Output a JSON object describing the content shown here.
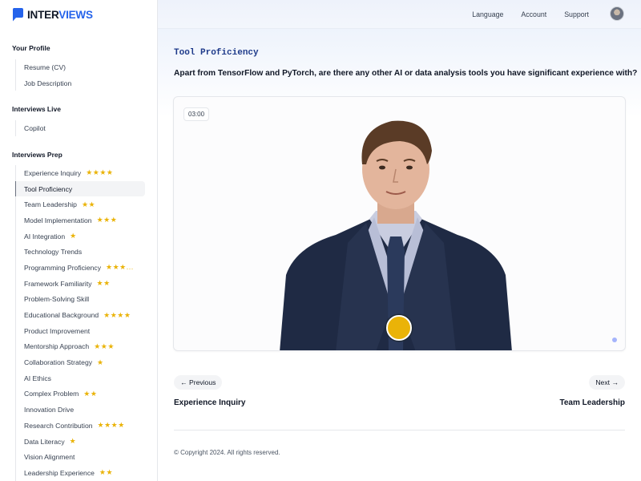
{
  "brand": {
    "name_bold": "INTER",
    "name_light": "VIEWS"
  },
  "topnav": [
    "Language",
    "Account",
    "Support"
  ],
  "sidebar": {
    "profile_title": "Your Profile",
    "profile_items": [
      "Resume (CV)",
      "Job Description"
    ],
    "live_title": "Interviews Live",
    "live_items": [
      "Copilot"
    ],
    "prep_title": "Interviews Prep",
    "prep_items": [
      {
        "label": "Experience Inquiry",
        "stars": "★★★★"
      },
      {
        "label": "Tool Proficiency",
        "stars": ""
      },
      {
        "label": "Team Leadership",
        "stars": "★★"
      },
      {
        "label": "Model Implementation",
        "stars": "★★★"
      },
      {
        "label": "AI Integration",
        "stars": "★"
      },
      {
        "label": "Technology Trends",
        "stars": ""
      },
      {
        "label": "Programming Proficiency",
        "stars": "★★★..."
      },
      {
        "label": "Framework Familiarity",
        "stars": "★★"
      },
      {
        "label": "Problem-Solving Skill",
        "stars": ""
      },
      {
        "label": "Educational Background",
        "stars": "★★★★"
      },
      {
        "label": "Product Improvement",
        "stars": ""
      },
      {
        "label": "Mentorship Approach",
        "stars": "★★★"
      },
      {
        "label": "Collaboration Strategy",
        "stars": "★"
      },
      {
        "label": "AI Ethics",
        "stars": ""
      },
      {
        "label": "Complex Problem",
        "stars": "★★"
      },
      {
        "label": "Innovation Drive",
        "stars": ""
      },
      {
        "label": "Research Contribution",
        "stars": "★★★★"
      },
      {
        "label": "Data Literacy",
        "stars": "★"
      },
      {
        "label": "Vision Alignment",
        "stars": ""
      },
      {
        "label": "Leadership Experience",
        "stars": "★★"
      }
    ]
  },
  "main": {
    "title": "Tool Proficiency",
    "question": "Apart from TensorFlow and PyTorch, are there any other AI or data analysis tools you have significant experience with?",
    "timer": "03:00",
    "prev_button": "← Previous",
    "next_button": "Next →",
    "prev_topic": "Experience Inquiry",
    "next_topic": "Team Leadership",
    "copyright": "© Copyright 2024. All rights reserved."
  },
  "colors": {
    "accent": "#eab308",
    "brand": "#2563eb",
    "title": "#1e3a8a"
  }
}
